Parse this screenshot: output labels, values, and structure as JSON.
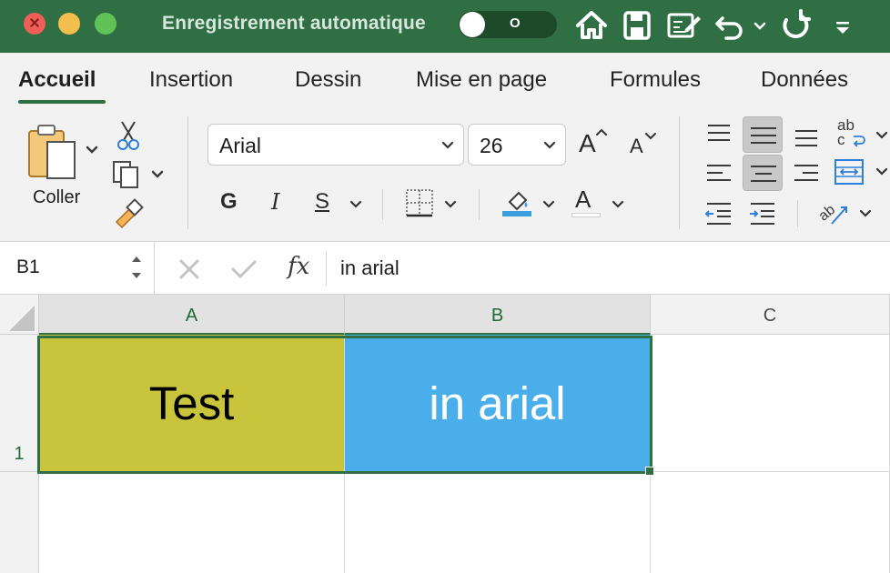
{
  "titlebar": {
    "title": "Enregistrement automatique",
    "autosave_state": "O"
  },
  "tabs": [
    "Accueil",
    "Insertion",
    "Dessin",
    "Mise en page",
    "Formules",
    "Données"
  ],
  "active_tab": "Accueil",
  "ribbon": {
    "paste_label": "Coller",
    "font_name": "Arial",
    "font_size": "26",
    "bold_label": "G",
    "italic_label": "I",
    "underline_label": "S",
    "font_color_label": "A",
    "increase_font_label": "A",
    "decrease_font_label": "A",
    "wrap_label": "ab c"
  },
  "formula_bar": {
    "name_box": "B1",
    "fx_label": "fx",
    "content": "in arial"
  },
  "grid": {
    "columns": [
      "A",
      "B",
      "C"
    ],
    "rows": [
      "1"
    ],
    "cells": {
      "A1": {
        "text": "Test",
        "fill": "#c8c43c",
        "color": "#000000"
      },
      "B1": {
        "text": "in arial",
        "fill": "#4aaeea",
        "color": "#ffffff"
      }
    }
  },
  "colors": {
    "accent": "#2f6f43",
    "fill_color_bar": "#3b9fdf"
  }
}
